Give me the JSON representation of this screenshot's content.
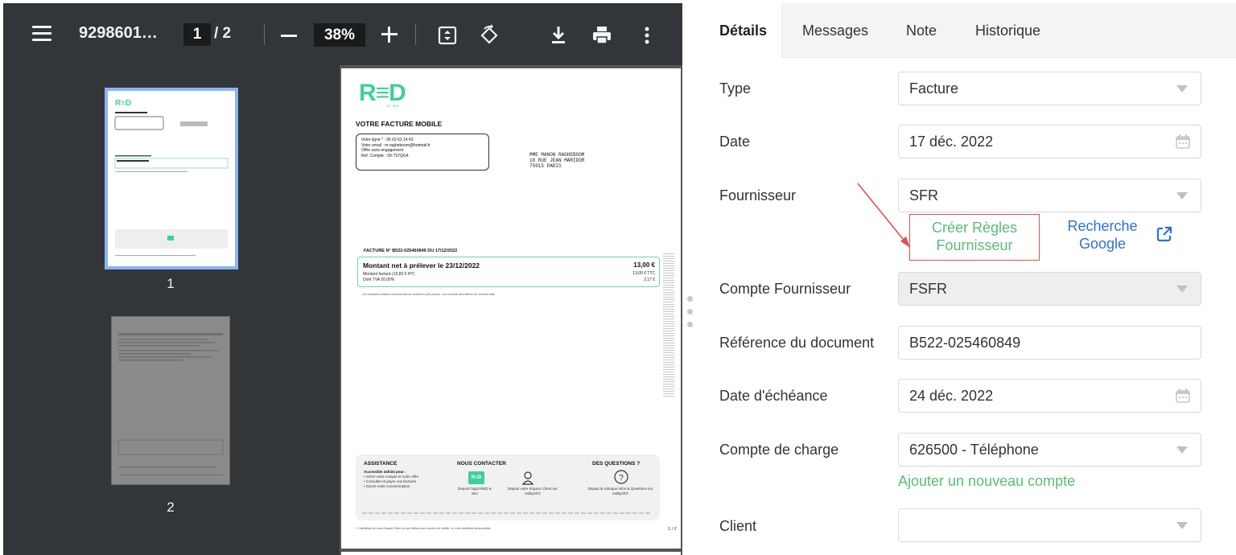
{
  "viewer": {
    "doc_title": "9298601…",
    "current_page": "1",
    "page_separator": "/ 2",
    "zoom": "38%",
    "thumbnails": [
      {
        "number": "1"
      },
      {
        "number": "2"
      }
    ]
  },
  "invoice_page": {
    "logo": "R≡D",
    "logo_sub": "BY SFR",
    "heading": "VOTRE FACTURE MOBILE",
    "info_box": [
      "Votre ligne * : 06 63 63 14 43",
      "Votre email : m.ragheboom@hotmail.fr",
      "Offre sans engagement",
      "Ref. Compte : 09-T57QG4"
    ],
    "address": [
      "MME MANON RAGHEBOOM",
      "18 RUE JEAN MARIDOR",
      "75015 PARIS"
    ],
    "invoice_number": "FACTURE N° B522-025460849 DU 17/12/2022",
    "amount_title": "Montant net à prélever le 23/12/2022",
    "amount_line1": "Montant facturé (10,83 € HT)",
    "amount_line2": "Dont TVA  20,00%",
    "amount_value": "13,00 €",
    "amount_ttc": "13,00 € TTC",
    "amount_tva": "2,17 €",
    "rounding_note": "Les montants unitaires sont arrondis au centime le plus proche. Leur somme peut différer du montant total.",
    "footer": {
      "assistance_title": "ASSISTANCE",
      "assistance_lines": [
        "Accessible 24h/24 pour :",
        "• Gérer votre compte et votre offre",
        "• Consulter et payer vos factures",
        "• Suivre votre consommation"
      ],
      "contact_title": "NOUS CONTACTER",
      "contact_app": "Depuis l'appli RED & Moi",
      "contact_web": "Depuis votre Espace Client sur redbysfr.fr",
      "questions_title": "DES QUESTIONS ?",
      "questions_text": "Depuis la rubrique Infos & Questions sur redbysfr.fr"
    },
    "page_footer": "* L'identifiant de votre Espace Client est par défaut votre numéro de mobile, ou votre identifiant personnalisé.",
    "page_number": "1 / 2"
  },
  "tabs": [
    {
      "label": "Détails",
      "active": true
    },
    {
      "label": "Messages",
      "active": false
    },
    {
      "label": "Note",
      "active": false
    },
    {
      "label": "Historique",
      "active": false
    }
  ],
  "form": {
    "type": {
      "label": "Type",
      "value": "Facture"
    },
    "date": {
      "label": "Date",
      "value": "17 déc. 2022"
    },
    "supplier": {
      "label": "Fournisseur",
      "value": "SFR"
    },
    "create_rules": "Créer Règles Fournisseur",
    "google_search": "Recherche Google",
    "supplier_account": {
      "label": "Compte Fournisseur",
      "value": "FSFR"
    },
    "doc_ref": {
      "label": "Référence du document",
      "value": "B522-025460849"
    },
    "due_date": {
      "label": "Date d'échéance",
      "value": "24 déc. 2022"
    },
    "charge_account": {
      "label": "Compte de charge",
      "value": "626500 - Téléphone"
    },
    "add_account": "Ajouter un nouveau compte",
    "client": {
      "label": "Client",
      "value": ""
    }
  },
  "colors": {
    "accent_green": "#57bd77",
    "link_blue": "#2f6fd6",
    "highlight_red": "#d9534f",
    "red_brand": "#3fd09a"
  }
}
